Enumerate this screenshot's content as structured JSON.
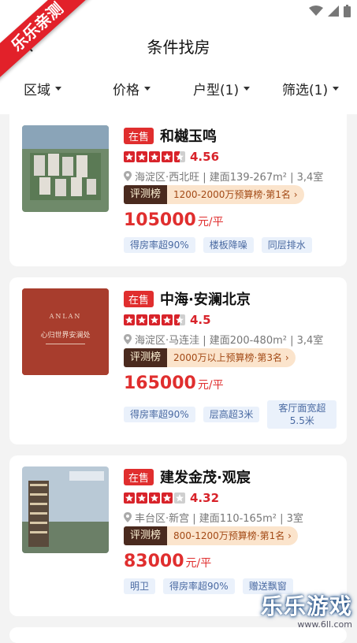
{
  "ribbon": "乐乐亲测",
  "header": {
    "title": "条件找房"
  },
  "filters": [
    {
      "label": "区域"
    },
    {
      "label": "价格"
    },
    {
      "label": "户型(1)"
    },
    {
      "label": "筛选(1)"
    }
  ],
  "listings": [
    {
      "status": "在售",
      "name": "和樾玉鸣",
      "stars_filled": 4.5,
      "score": "4.56",
      "meta": "海淀区·西北旺 | 建面139-267m² | 3,4室",
      "rank_tag": "评测榜",
      "rank_text": "1200-2000万预算榜·第1名",
      "price": "105000",
      "price_unit": "元/平",
      "tags": [
        "得房率超90%",
        "楼板降噪",
        "同层排水"
      ]
    },
    {
      "status": "在售",
      "name": "中海·安澜北京",
      "stars_filled": 4.5,
      "score": "4.5",
      "meta": "海淀区·马连洼 | 建面200-480m² | 3,4室",
      "rank_tag": "评测榜",
      "rank_text": "2000万以上预算榜·第3名",
      "price": "165000",
      "price_unit": "元/平",
      "tags": [
        "得房率超90%",
        "层高超3米",
        "客厅面宽超5.5米"
      ],
      "thumb_text": {
        "brand": "ANLAN",
        "slogan": "心归世界安澜处"
      }
    },
    {
      "status": "在售",
      "name": "建发金茂·观宸",
      "stars_filled": 4,
      "score": "4.32",
      "meta": "丰台区·新宫 | 建面110-165m² | 3室",
      "rank_tag": "评测榜",
      "rank_text": "800-1200万预算榜·第1名",
      "price": "83000",
      "price_unit": "元/平",
      "tags": [
        "明卫",
        "得房率超90%",
        "赠送飘窗"
      ]
    }
  ],
  "watermark": {
    "big": "乐乐游戏",
    "small": "www.6ll.com"
  },
  "colors": {
    "accent": "#e02e2e",
    "rank_bg": "#4a2a1e",
    "tag_bg": "#eaf1fb"
  }
}
